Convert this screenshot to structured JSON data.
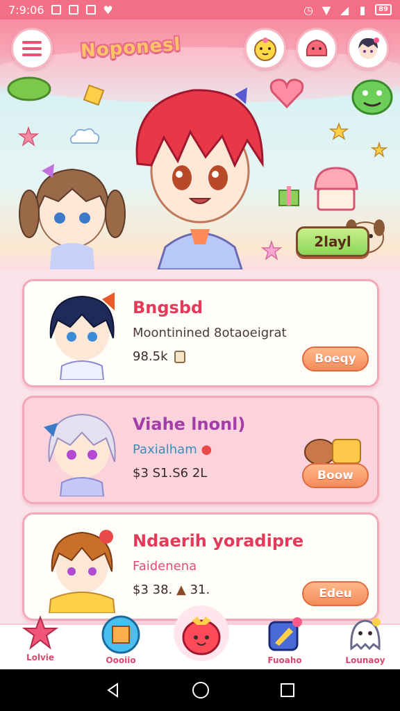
{
  "status_bar": {
    "time": "7:9:06",
    "battery": "89"
  },
  "header": {
    "title": "Noponesl",
    "play_label": "2layl"
  },
  "cards": [
    {
      "title": "Bngsbd",
      "subtitle": "Moontinined 8otaoeigrat",
      "price": "98.5k",
      "button": "Boeqy"
    },
    {
      "title": "Viahe lnonl)",
      "subtitle": "Paxialham",
      "price": "$3 S1.S6 2L",
      "button": "Boow"
    },
    {
      "title": "Ndaerih yoradipre",
      "subtitle": "Faidenena",
      "price": "$3 38.",
      "price_suffix": "31.",
      "button": "Edeu"
    }
  ],
  "bottom_nav": [
    {
      "label": "Lolvie",
      "icon": "star-icon"
    },
    {
      "label": "Oooiio",
      "icon": "box-icon"
    },
    {
      "label": "",
      "icon": "strawberry-icon"
    },
    {
      "label": "Fuoaho",
      "icon": "paint-icon"
    },
    {
      "label": "Lounaoy",
      "icon": "ghost-icon"
    }
  ],
  "colors": {
    "accent": "#f26f86",
    "title_red": "#e23a58",
    "button_orange": "#f58b5c",
    "play_green": "#8cd65a"
  }
}
